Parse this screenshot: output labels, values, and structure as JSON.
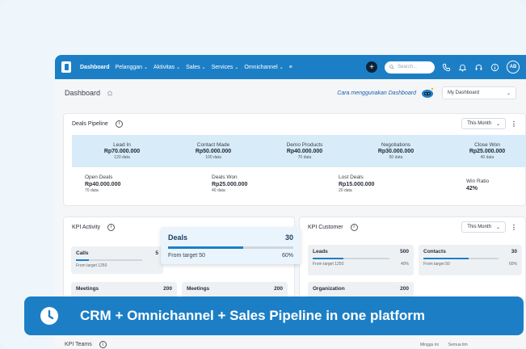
{
  "topbar": {
    "nav": [
      {
        "label": "Dashboard",
        "active": true,
        "caret": false
      },
      {
        "label": "Pelanggan",
        "caret": true
      },
      {
        "label": "Aktivitas",
        "caret": true
      },
      {
        "label": "Sales",
        "caret": true
      },
      {
        "label": "Services",
        "caret": true
      },
      {
        "label": "Omnichannel",
        "caret": true
      }
    ],
    "search_placeholder": "Search...",
    "avatar_initials": "AB"
  },
  "title_bar": {
    "title": "Dashboard",
    "help_link": "Cara menggunakan Dashboard",
    "dashboard_select": "My Dashboard"
  },
  "pipeline": {
    "title": "Deals Pipeline",
    "period": "This Month",
    "stages": [
      {
        "name": "Lead In",
        "value": "Rp70.000.000",
        "count": "120 data"
      },
      {
        "name": "Contact Made",
        "value": "Rp50.000.000",
        "count": "100 data"
      },
      {
        "name": "Demo Products",
        "value": "Rp40.000.000",
        "count": "70 data"
      },
      {
        "name": "Negotiations",
        "value": "Rp30.000.000",
        "count": "50 data"
      },
      {
        "name": "Close Won",
        "value": "Rp25.000.000",
        "count": "40 data"
      }
    ],
    "summary": [
      {
        "label": "Open Deals",
        "value": "Rp40.000.000",
        "count": "70 data"
      },
      {
        "label": "Deals Won",
        "value": "Rp25.000.000",
        "count": "40 data"
      },
      {
        "label": "Lost Deals",
        "value": "Rp15.000.000",
        "count": "20 data"
      },
      {
        "label": "Win Ratio",
        "value": "42%",
        "count": ""
      }
    ]
  },
  "kpi_activity": {
    "title": "KPI Activity",
    "tiles": [
      {
        "name": "Calls",
        "value": "5",
        "foot": "From target 1250",
        "pct": "",
        "fill": 0.2
      },
      {
        "name": "Meetings",
        "value": "200",
        "foot": "",
        "pct": "",
        "fill": 0
      },
      {
        "name": "Meetings",
        "value": "200",
        "foot": "",
        "pct": "",
        "fill": 0
      }
    ],
    "popup": {
      "name": "Deals",
      "value": "30",
      "foot": "From target 50",
      "pct": "60%",
      "fill": 0.6
    }
  },
  "kpi_customer": {
    "title": "KPI Customer",
    "period": "This Month",
    "tiles": [
      {
        "name": "Leads",
        "value": "500",
        "foot": "From target 1250",
        "pct": "40%",
        "fill": 0.4
      },
      {
        "name": "Contacts",
        "value": "30",
        "foot": "From target 50",
        "pct": "60%",
        "fill": 0.6
      },
      {
        "name": "Organization",
        "value": "200",
        "foot": "",
        "pct": "",
        "fill": 0
      }
    ]
  },
  "kpi_teams": {
    "title": "KPI Teams",
    "filter_1": "Minggu ini",
    "filter_2": "Semua tim"
  },
  "banner": {
    "text": "CRM + Omnichannel + Sales Pipeline in one platform"
  },
  "colors": {
    "primary": "#1c7fc6",
    "stage": "#d7ecf8",
    "banner": "#1c7fc6"
  }
}
